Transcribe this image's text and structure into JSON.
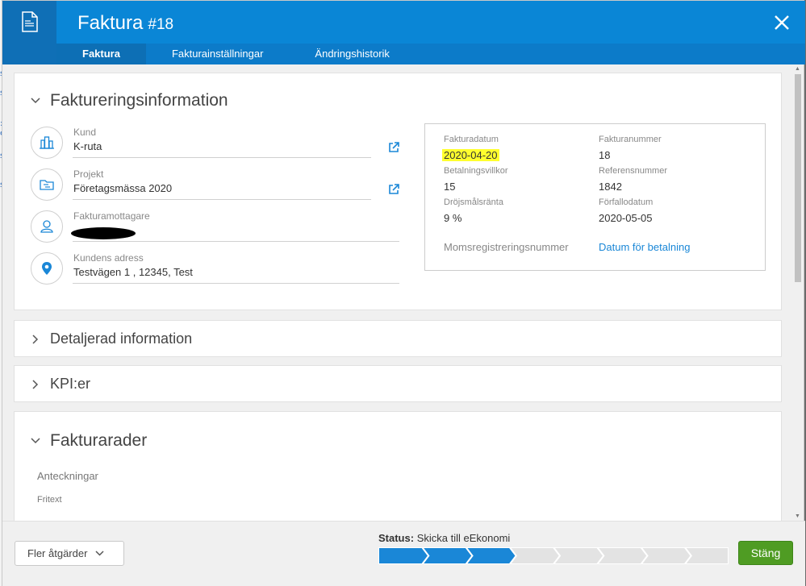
{
  "header": {
    "title": "Faktura",
    "number": "#18",
    "tabs": [
      {
        "label": "Faktura",
        "active": true
      },
      {
        "label": "Fakturainställningar",
        "active": false
      },
      {
        "label": "Ändringshistorik",
        "active": false
      }
    ]
  },
  "billing": {
    "title": "Faktureringsinformation",
    "fields": [
      {
        "label": "Kund",
        "value": "K-ruta",
        "icon": "building-icon"
      },
      {
        "label": "Projekt",
        "value": "Företagsmässa 2020",
        "icon": "folder-icon"
      },
      {
        "label": "Fakturamottagare",
        "value": "",
        "icon": "person-icon"
      },
      {
        "label": "Kundens adress",
        "value": "Testvägen 1 , 12345, Test",
        "icon": "location-pin-icon"
      }
    ],
    "info": {
      "fakturadatum_label": "Fakturadatum",
      "fakturadatum_value": "2020-04-20",
      "fakturanummer_label": "Fakturanummer",
      "fakturanummer_value": "18",
      "betalningsvillkor_label": "Betalningsvillkor",
      "betalningsvillkor_value": "15",
      "referensnummer_label": "Referensnummer",
      "referensnummer_value": "1842",
      "drojsmalsranta_label": "Dröjsmålsränta",
      "drojsmalsranta_value": "9 %",
      "forfallodatum_label": "Förfallodatum",
      "forfallodatum_value": "2020-05-05",
      "moms_label": "Momsregistreringsnummer",
      "datum_betalning_link": "Datum för betalning"
    },
    "highlight_color": "#ffff2e"
  },
  "sections": {
    "detaljerad": "Detaljerad information",
    "kpi": "KPI:er",
    "fakturarader": "Fakturarader",
    "anteckningar": "Anteckningar",
    "fritext": "Fritext"
  },
  "footer": {
    "more_actions": "Fler åtgärder",
    "status_label": "Status:",
    "status_value": "Skicka till eEkonomi",
    "progress_total_steps": 8,
    "progress_done_steps": 3,
    "close_button": "Stäng"
  },
  "colors": {
    "header": "#0a86d6",
    "accent": "#1a87d7",
    "success": "#4f9c23"
  }
}
